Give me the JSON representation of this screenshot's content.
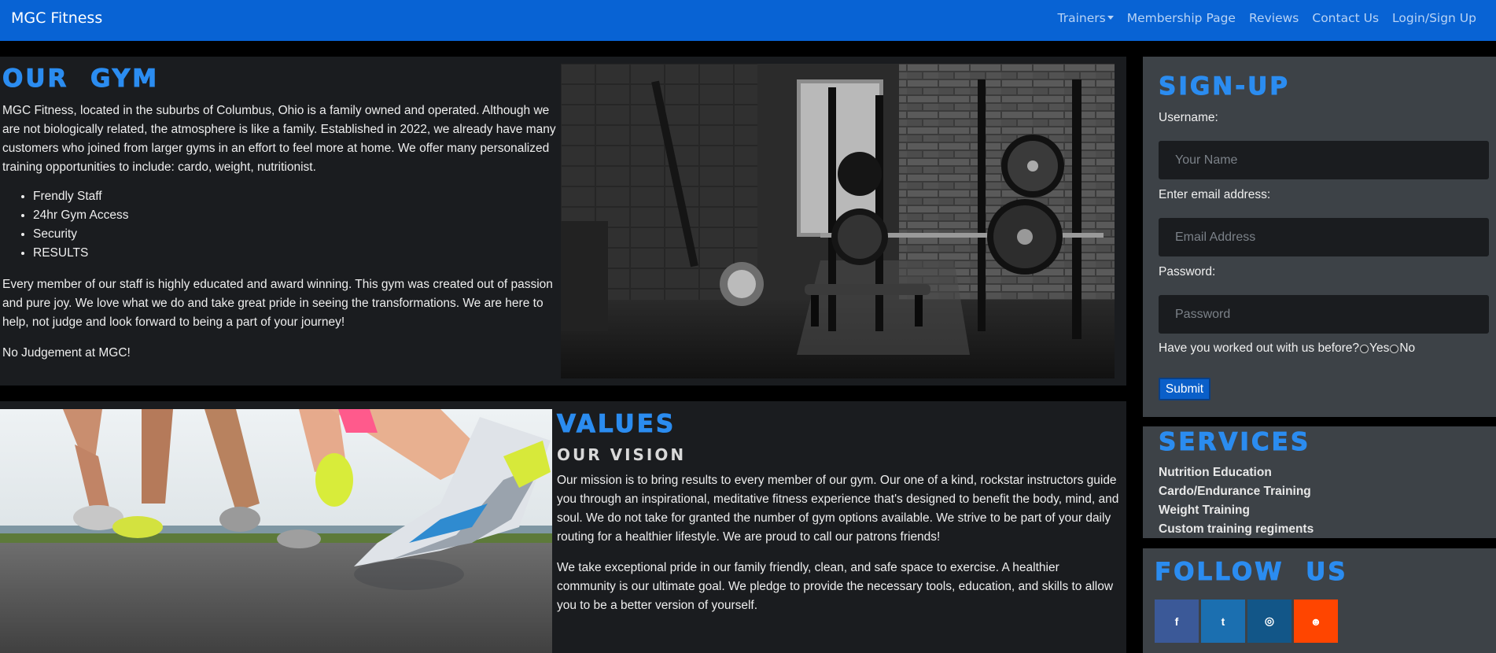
{
  "nav": {
    "brand": "MGC Fitness",
    "links": [
      "Trainers",
      "Membership Page",
      "Reviews",
      "Contact Us",
      "Login/Sign Up"
    ]
  },
  "gym": {
    "title": "OUR  GYM",
    "intro": "MGC Fitness, located in the suburbs of Columbus, Ohio is a family owned and operated. Although we are not biologically related, the atmosphere is like a family. Established in 2022, we already have many customers who joined from larger gyms in an effort to feel more at home. We offer many personalized training opportunities to include: cardo, weight, nutritionist.",
    "features": [
      "Frendly Staff",
      "24hr Gym Access",
      "Security",
      "RESULTS"
    ],
    "staff": "Every member of our staff is highly educated and award winning. This gym was created out of passion and pure joy. We love what we do and take great pride in seeing the transformations. We are here to help, not judge and look forward to being a part of your journey!",
    "tagline": "No Judgement at MGC!"
  },
  "values": {
    "title": "VALUES",
    "subtitle": "OUR VISION",
    "mission": "Our mission is to bring results to every member of our gym. Our one of a kind, rockstar instructors guide you through an inspirational, meditative fitness experience that's designed to benefit the body, mind, and soul. We do not take for granted the number of gym options available. We strive to be part of your daily routing for a healthier lifestyle. We are proud to call our patrons friends!",
    "pride": "We take exceptional pride in our family friendly, clean, and safe space to exercise. A healthier community is our ultimate goal. We pledge to provide the necessary tools, education, and skills to allow you to be a better version of yourself."
  },
  "signup": {
    "title": "SIGN-UP",
    "username_label": "Username:",
    "username_placeholder": "Your Name",
    "email_label": "Enter email address:",
    "email_placeholder": "Email Address",
    "password_label": "Password:",
    "password_placeholder": "Password",
    "question": "Have you worked out with us before?",
    "yes": "Yes",
    "no": "No",
    "submit": "Submit"
  },
  "services": {
    "title": "SERVICES",
    "items": [
      "Nutrition Education",
      "Cardo/Endurance Training",
      "Weight Training",
      "Custom training regiments"
    ]
  },
  "follow": {
    "title": "FOLLOW  US",
    "icons": [
      {
        "name": "facebook-icon",
        "glyph": "f",
        "color": "#3b5998"
      },
      {
        "name": "twitter-icon",
        "glyph": "t",
        "color": "#1b6fb0"
      },
      {
        "name": "instagram-icon",
        "glyph": "◎",
        "color": "#125688"
      },
      {
        "name": "reddit-icon",
        "glyph": "☻",
        "color": "#ff4500"
      }
    ]
  }
}
